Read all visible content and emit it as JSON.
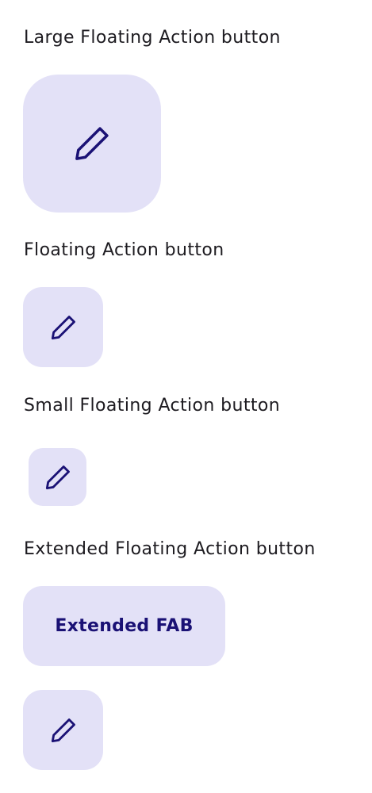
{
  "sections": {
    "large": {
      "title": "Large Floating Action button",
      "icon": "pencil-icon"
    },
    "regular": {
      "title": "Floating Action button",
      "icon": "pencil-icon"
    },
    "small": {
      "title": "Small Floating Action button",
      "icon": "pencil-icon"
    },
    "extended": {
      "title": "Extended Floating Action button",
      "button_label": "Extended FAB",
      "icon": "pencil-icon"
    }
  },
  "colors": {
    "fab_container": "#e3e1f7",
    "icon": "#1a1175",
    "label_text": "#1d1b20"
  }
}
